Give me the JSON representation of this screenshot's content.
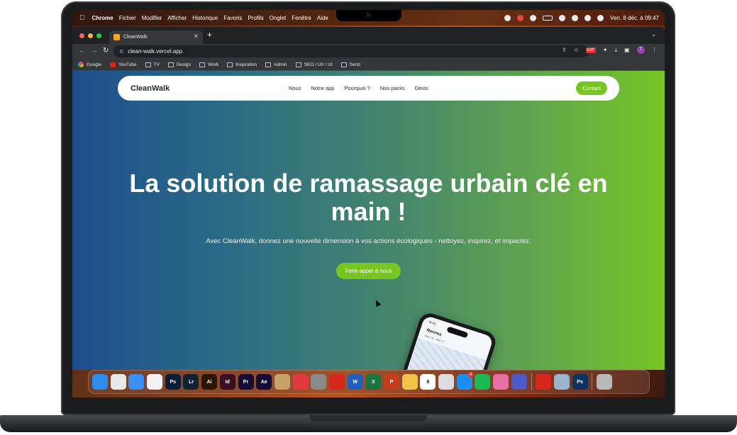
{
  "menubar": {
    "app_name": "Chrome",
    "items": [
      "Fichier",
      "Modifier",
      "Afficher",
      "Historique",
      "Favoris",
      "Profils",
      "Onglet",
      "Fenêtre",
      "Aide"
    ],
    "clock": "Ven. 8 déc. à 09:47"
  },
  "browser": {
    "tab_title": "CleanWalk",
    "url": "clean-walk.vercel.app",
    "extension_badge": "EXP",
    "profile_initial": "T",
    "bookmarks": [
      "Google",
      "YouTube",
      "TV",
      "Design",
      "Work",
      "Inspiration",
      "Admin",
      "SEO / UX / UI",
      "Send"
    ]
  },
  "site": {
    "logo": "CleanWalk",
    "nav": [
      "Nous",
      "Notre app",
      "Pourquoi ?",
      "Nos packs",
      "Devis"
    ],
    "contact": "Contact",
    "hero_title": "La solution de ramassage urbain clé en main !",
    "hero_subtitle": "Avec CleanWalk, donnez une nouvelle dimension à vos actions écologiques - nettoyez, inspirez, et impactez.",
    "cta": "Faire appel à nous",
    "phone": {
      "time": "9:41",
      "city": "Rennes",
      "dates": "Mar 12 – Mar 17"
    }
  },
  "dock": {
    "apps": [
      {
        "name": "finder",
        "label": "",
        "color": "#2d8cf0"
      },
      {
        "name": "chrome",
        "label": "",
        "color": "#e8e8e8"
      },
      {
        "name": "mail",
        "label": "",
        "color": "#3a8ef6"
      },
      {
        "name": "reminders",
        "label": "",
        "color": "#f2f2f2"
      },
      {
        "name": "photoshop",
        "label": "Ps",
        "color": "#0b1e35"
      },
      {
        "name": "lightroom",
        "label": "Lr",
        "color": "#0e2233"
      },
      {
        "name": "illustrator",
        "label": "Ai",
        "color": "#2d1300"
      },
      {
        "name": "indesign",
        "label": "Id",
        "color": "#3a0f24"
      },
      {
        "name": "premiere",
        "label": "Pr",
        "color": "#150b35"
      },
      {
        "name": "after-effects",
        "label": "Ae",
        "color": "#150b35"
      },
      {
        "name": "launchpad",
        "label": "",
        "color": "#c8a06a"
      },
      {
        "name": "creative-cloud",
        "label": "",
        "color": "#e03a3e"
      },
      {
        "name": "system-settings",
        "label": "",
        "color": "#8a8a8a"
      },
      {
        "name": "acrobat",
        "label": "",
        "color": "#d7261c"
      },
      {
        "name": "word",
        "label": "W",
        "color": "#1f5fbd"
      },
      {
        "name": "excel",
        "label": "X",
        "color": "#1c7440"
      },
      {
        "name": "powerpoint",
        "label": "P",
        "color": "#c43e1c"
      },
      {
        "name": "photos",
        "label": "",
        "color": "#f0c24a"
      },
      {
        "name": "calendar",
        "label": "8",
        "color": "#ffffff"
      },
      {
        "name": "screenshot",
        "label": "",
        "color": "#dcdcdc"
      },
      {
        "name": "app-store",
        "label": "",
        "color": "#1e8ef5",
        "badge": "6"
      },
      {
        "name": "spotify",
        "label": "",
        "color": "#1db954"
      },
      {
        "name": "cleanmymac",
        "label": "",
        "color": "#e86fa6"
      },
      {
        "name": "teams",
        "label": "",
        "color": "#5059c9"
      },
      {
        "name": "acrobat-2",
        "label": "",
        "color": "#d7261c"
      },
      {
        "name": "preview",
        "label": "",
        "color": "#9bb3cf"
      },
      {
        "name": "photoshop-2",
        "label": "Ps",
        "color": "#0b3560"
      },
      {
        "name": "trash",
        "label": "",
        "color": "#b9b9b9"
      }
    ]
  }
}
